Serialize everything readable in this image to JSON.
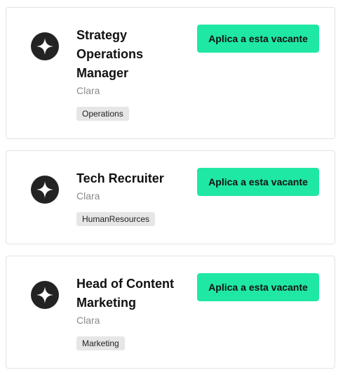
{
  "jobs": [
    {
      "title": "Strategy Operations Manager",
      "company": "Clara",
      "tag": "Operations",
      "apply_label": "Aplica a esta vacante",
      "logo_icon": "sparkle-icon"
    },
    {
      "title": "Tech Recruiter",
      "company": "Clara",
      "tag": "HumanResources",
      "apply_label": "Aplica a esta vacante",
      "logo_icon": "sparkle-icon"
    },
    {
      "title": "Head of Content Marketing",
      "company": "Clara",
      "tag": "Marketing",
      "apply_label": "Aplica a esta vacante",
      "logo_icon": "sparkle-icon"
    }
  ],
  "colors": {
    "accent": "#1fe8a4",
    "logo_bg": "#232323",
    "tag_bg": "#e6e6e6",
    "muted_text": "#8a8a8a"
  }
}
